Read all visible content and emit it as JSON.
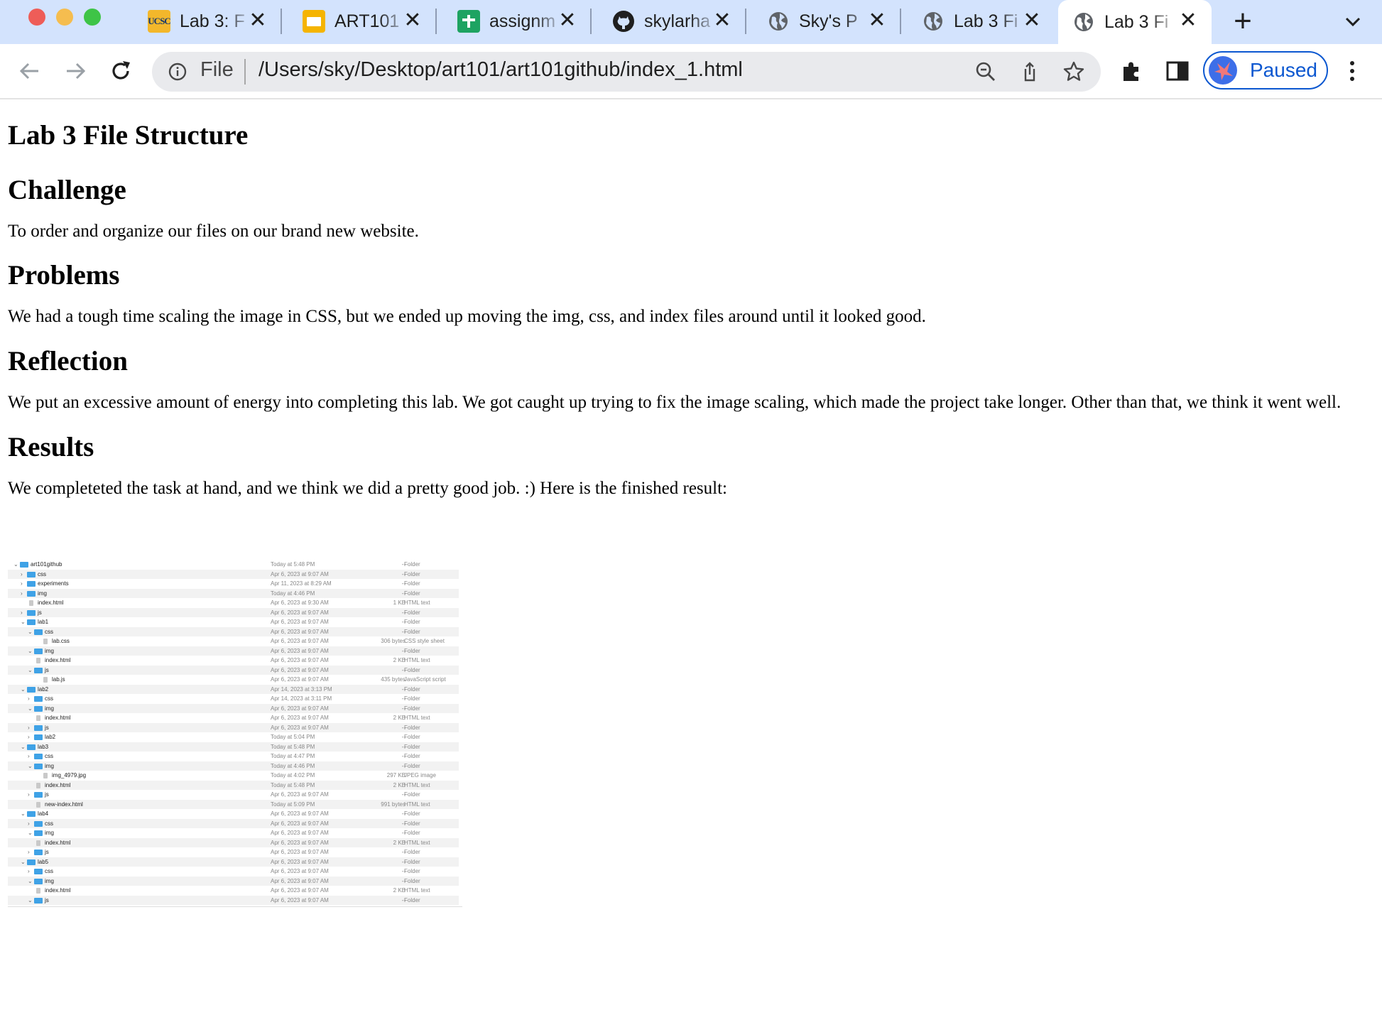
{
  "browser": {
    "tabs": [
      {
        "title": "Lab 3: F",
        "icon": "ucsc-favicon",
        "active": false
      },
      {
        "title": "ART101",
        "icon": "slides-favicon",
        "active": false
      },
      {
        "title": "assignm",
        "icon": "sheets-favicon",
        "active": false
      },
      {
        "title": "skylarha",
        "icon": "github-favicon",
        "active": false
      },
      {
        "title": "Sky's P",
        "icon": "globe-icon",
        "active": false
      },
      {
        "title": "Lab 3 Fi",
        "icon": "globe-icon",
        "active": false
      },
      {
        "title": "Lab 3 Fi",
        "icon": "globe-icon",
        "active": true
      }
    ],
    "favicon_text": "UCSC",
    "address": {
      "scheme": "File",
      "url": "/Users/sky/Desktop/art101/art101github/index_1.html"
    },
    "profile_label": "Paused",
    "accent": "#0b57d0",
    "tabstrip_color": "#d3e3fd"
  },
  "page": {
    "title": "Lab 3 File Structure",
    "sections": [
      {
        "heading": "Challenge",
        "body": "To order and organize our files on our brand new website."
      },
      {
        "heading": "Problems",
        "body": "We had a tough time scaling the image in CSS, but we ended up moving the img, css, and index files around until it looked good."
      },
      {
        "heading": "Reflection",
        "body": "We put an excessive amount of energy into completing this lab. We got caught up trying to fix the image scaling, which made the project take longer. Other than that, we think it went well."
      },
      {
        "heading": "Results",
        "body": "We completeted the task at hand, and we think we did a pretty good job. :) Here is the finished result:"
      }
    ]
  },
  "finder_screenshot": {
    "rows": [
      {
        "name": "art101github",
        "depth": 0,
        "type": "folder",
        "open": true,
        "date": "Today at 5:48 PM",
        "size": "--",
        "kind": "Folder"
      },
      {
        "name": "css",
        "depth": 1,
        "type": "folder",
        "open": false,
        "date": "Apr 6, 2023 at 9:07 AM",
        "size": "--",
        "kind": "Folder"
      },
      {
        "name": "experiments",
        "depth": 1,
        "type": "folder",
        "open": false,
        "date": "Apr 11, 2023 at 8:29 AM",
        "size": "--",
        "kind": "Folder"
      },
      {
        "name": "img",
        "depth": 1,
        "type": "folder",
        "open": false,
        "date": "Today at 4:46 PM",
        "size": "--",
        "kind": "Folder"
      },
      {
        "name": "index.html",
        "depth": 1,
        "type": "file",
        "date": "Apr 6, 2023 at 9:30 AM",
        "size": "1 KB",
        "kind": "HTML text"
      },
      {
        "name": "js",
        "depth": 1,
        "type": "folder",
        "open": false,
        "date": "Apr 6, 2023 at 9:07 AM",
        "size": "--",
        "kind": "Folder"
      },
      {
        "name": "lab1",
        "depth": 1,
        "type": "folder",
        "open": true,
        "date": "Apr 6, 2023 at 9:07 AM",
        "size": "--",
        "kind": "Folder"
      },
      {
        "name": "css",
        "depth": 2,
        "type": "folder",
        "open": true,
        "date": "Apr 6, 2023 at 9:07 AM",
        "size": "--",
        "kind": "Folder"
      },
      {
        "name": "lab.css",
        "depth": 3,
        "type": "file",
        "date": "Apr 6, 2023 at 9:07 AM",
        "size": "306 bytes",
        "kind": "CSS style sheet"
      },
      {
        "name": "img",
        "depth": 2,
        "type": "folder",
        "open": true,
        "date": "Apr 6, 2023 at 9:07 AM",
        "size": "--",
        "kind": "Folder"
      },
      {
        "name": "index.html",
        "depth": 2,
        "type": "file",
        "date": "Apr 6, 2023 at 9:07 AM",
        "size": "2 KB",
        "kind": "HTML text"
      },
      {
        "name": "js",
        "depth": 2,
        "type": "folder",
        "open": true,
        "date": "Apr 6, 2023 at 9:07 AM",
        "size": "--",
        "kind": "Folder"
      },
      {
        "name": "lab.js",
        "depth": 3,
        "type": "file",
        "date": "Apr 6, 2023 at 9:07 AM",
        "size": "435 bytes",
        "kind": "JavaScript script"
      },
      {
        "name": "lab2",
        "depth": 1,
        "type": "folder",
        "open": true,
        "date": "Apr 14, 2023 at 3:13 PM",
        "size": "--",
        "kind": "Folder"
      },
      {
        "name": "css",
        "depth": 2,
        "type": "folder",
        "open": false,
        "date": "Apr 14, 2023 at 3:11 PM",
        "size": "--",
        "kind": "Folder"
      },
      {
        "name": "img",
        "depth": 2,
        "type": "folder",
        "open": true,
        "date": "Apr 6, 2023 at 9:07 AM",
        "size": "--",
        "kind": "Folder"
      },
      {
        "name": "index.html",
        "depth": 2,
        "type": "file",
        "date": "Apr 6, 2023 at 9:07 AM",
        "size": "2 KB",
        "kind": "HTML text"
      },
      {
        "name": "js",
        "depth": 2,
        "type": "folder",
        "open": false,
        "date": "Apr 6, 2023 at 9:07 AM",
        "size": "--",
        "kind": "Folder"
      },
      {
        "name": "lab2",
        "depth": 2,
        "type": "folder",
        "open": false,
        "date": "Today at 5:04 PM",
        "size": "--",
        "kind": "Folder"
      },
      {
        "name": "lab3",
        "depth": 1,
        "type": "folder",
        "open": true,
        "date": "Today at 5:48 PM",
        "size": "--",
        "kind": "Folder"
      },
      {
        "name": "css",
        "depth": 2,
        "type": "folder",
        "open": false,
        "date": "Today at 4:47 PM",
        "size": "--",
        "kind": "Folder"
      },
      {
        "name": "img",
        "depth": 2,
        "type": "folder",
        "open": true,
        "date": "Today at 4:46 PM",
        "size": "--",
        "kind": "Folder"
      },
      {
        "name": "img_4979.jpg",
        "depth": 3,
        "type": "file",
        "date": "Today at 4:02 PM",
        "size": "297 KB",
        "kind": "JPEG image"
      },
      {
        "name": "index.html",
        "depth": 2,
        "type": "file",
        "date": "Today at 5:48 PM",
        "size": "2 KB",
        "kind": "HTML text"
      },
      {
        "name": "js",
        "depth": 2,
        "type": "folder",
        "open": false,
        "date": "Apr 6, 2023 at 9:07 AM",
        "size": "--",
        "kind": "Folder"
      },
      {
        "name": "new-index.html",
        "depth": 2,
        "type": "file",
        "date": "Today at 5:09 PM",
        "size": "991 bytes",
        "kind": "HTML text"
      },
      {
        "name": "lab4",
        "depth": 1,
        "type": "folder",
        "open": true,
        "date": "Apr 6, 2023 at 9:07 AM",
        "size": "--",
        "kind": "Folder"
      },
      {
        "name": "css",
        "depth": 2,
        "type": "folder",
        "open": false,
        "date": "Apr 6, 2023 at 9:07 AM",
        "size": "--",
        "kind": "Folder"
      },
      {
        "name": "img",
        "depth": 2,
        "type": "folder",
        "open": true,
        "date": "Apr 6, 2023 at 9:07 AM",
        "size": "--",
        "kind": "Folder"
      },
      {
        "name": "index.html",
        "depth": 2,
        "type": "file",
        "date": "Apr 6, 2023 at 9:07 AM",
        "size": "2 KB",
        "kind": "HTML text"
      },
      {
        "name": "js",
        "depth": 2,
        "type": "folder",
        "open": false,
        "date": "Apr 6, 2023 at 9:07 AM",
        "size": "--",
        "kind": "Folder"
      },
      {
        "name": "lab5",
        "depth": 1,
        "type": "folder",
        "open": true,
        "date": "Apr 6, 2023 at 9:07 AM",
        "size": "--",
        "kind": "Folder"
      },
      {
        "name": "css",
        "depth": 2,
        "type": "folder",
        "open": false,
        "date": "Apr 6, 2023 at 9:07 AM",
        "size": "--",
        "kind": "Folder"
      },
      {
        "name": "img",
        "depth": 2,
        "type": "folder",
        "open": true,
        "date": "Apr 6, 2023 at 9:07 AM",
        "size": "--",
        "kind": "Folder"
      },
      {
        "name": "index.html",
        "depth": 2,
        "type": "file",
        "date": "Apr 6, 2023 at 9:07 AM",
        "size": "2 KB",
        "kind": "HTML text"
      },
      {
        "name": "js",
        "depth": 2,
        "type": "folder",
        "open": true,
        "date": "Apr 6, 2023 at 9:07 AM",
        "size": "--",
        "kind": "Folder"
      }
    ]
  }
}
